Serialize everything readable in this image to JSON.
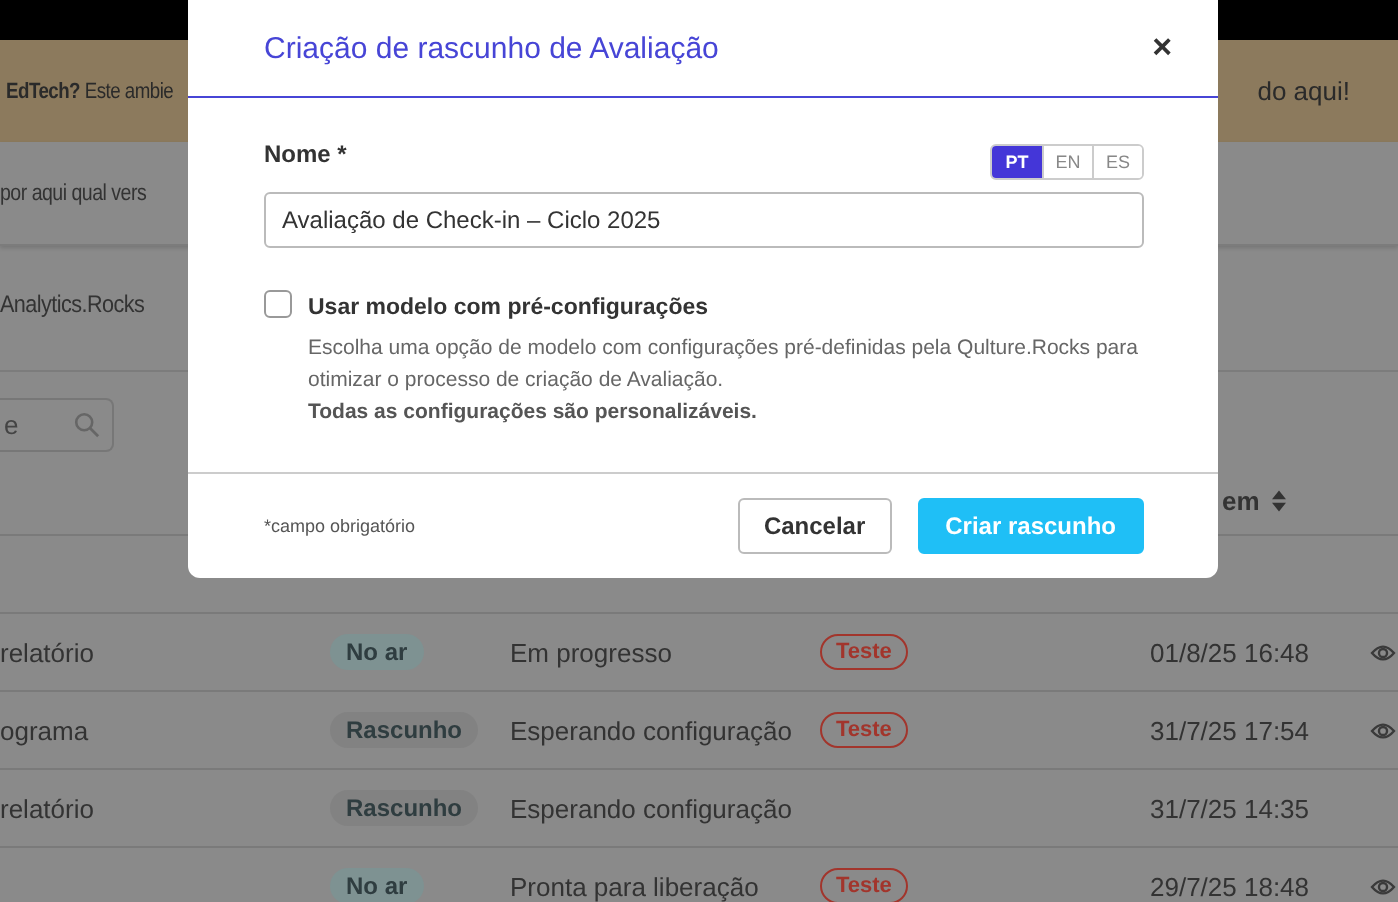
{
  "banner": {
    "left_text": "**EdTech?** Este ambie",
    "right_text": "do aqui!"
  },
  "notice": "por aqui qual vers",
  "tab": "Analytics.Rocks",
  "search": {
    "placeholder": "e"
  },
  "table": {
    "columns": [
      {
        "label": "em",
        "sortable": true
      }
    ],
    "rows": [
      {
        "name": "relatório",
        "badge": {
          "label": "No ar",
          "color": "#7e9292"
        },
        "status": "Em progresso",
        "tag": "Teste",
        "date": "01/8/25 16:48",
        "viewable": true
      },
      {
        "name": "ograma",
        "badge": {
          "label": "Rascunho",
          "color": "#828282"
        },
        "status": "Esperando configuração",
        "tag": "Teste",
        "date": "31/7/25 17:54",
        "viewable": true
      },
      {
        "name": "relatório",
        "badge": {
          "label": "Rascunho",
          "color": "#828282"
        },
        "status": "Esperando configuração",
        "date": "31/7/25 14:35",
        "viewable": false
      },
      {
        "name": "",
        "badge": {
          "label": "No ar",
          "color": "#7e9292"
        },
        "status": "Pronta para liberação",
        "tag": "Teste",
        "date": "29/7/25 18:48",
        "viewable": true
      }
    ]
  },
  "modal": {
    "title": "Criação de rascunho de Avaliação",
    "close": "×",
    "name_label": "Nome *",
    "languages": [
      {
        "label": "PT",
        "selected": true
      },
      {
        "label": "EN",
        "selected": false
      },
      {
        "label": "ES",
        "selected": false
      }
    ],
    "name_value": "Avaliação de Check-in – Ciclo 2025",
    "template": {
      "label": "Usar modelo com pré-configurações",
      "checked": false,
      "description": "Escolha uma opção de modelo com configurações pré-definidas pela Qulture.Rocks para otimizar o processo de criação de Avaliação.",
      "note": "Todas as configurações são personalizáveis."
    },
    "required_note": "*campo obrigatório",
    "buttons": [
      {
        "label": "Cancelar",
        "kind": "secondary"
      },
      {
        "label": "Criar rascunho",
        "kind": "primary"
      }
    ]
  }
}
